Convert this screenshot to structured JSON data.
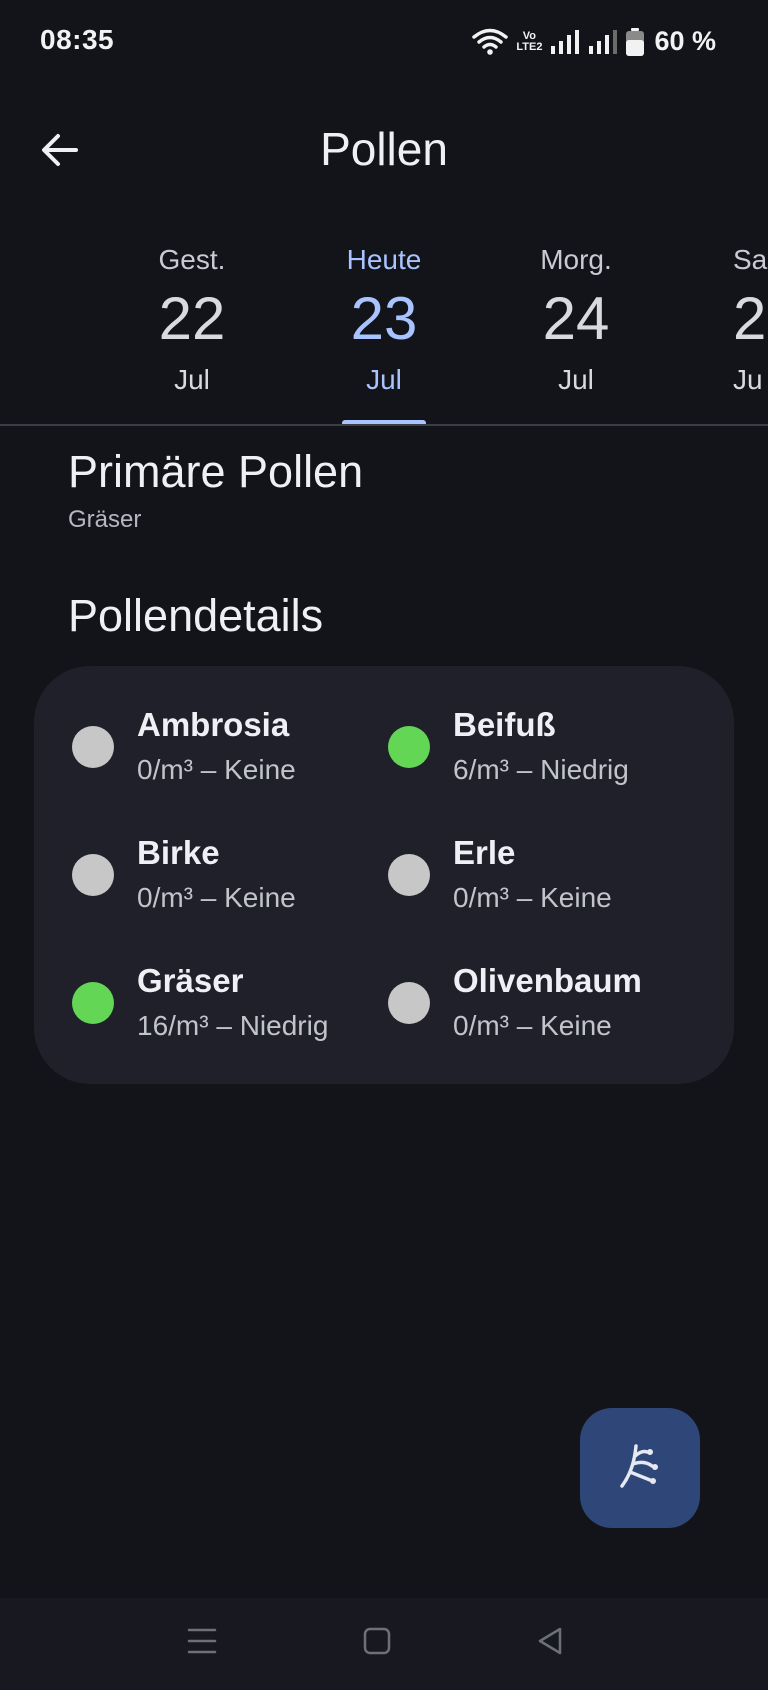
{
  "status_bar": {
    "time": "08:35",
    "volte_top": "Vo",
    "volte_bottom": "LTE2",
    "battery": "60 %"
  },
  "app_bar": {
    "title": "Pollen",
    "back_icon": "arrow-left-icon"
  },
  "date_tabs": [
    {
      "dow": "Gest.",
      "day": "22",
      "month": "Jul",
      "active": false
    },
    {
      "dow": "Heute",
      "day": "23",
      "month": "Jul",
      "active": true
    },
    {
      "dow": "Morg.",
      "day": "24",
      "month": "Jul",
      "active": false
    },
    {
      "dow": "Sa",
      "day": "2",
      "month": "Ju",
      "active": false
    }
  ],
  "primary": {
    "title": "Primäre Pollen",
    "value": "Gräser"
  },
  "details": {
    "title": "Pollendetails",
    "items": [
      {
        "name": "Ambrosia",
        "value": "0/m³ – Keine",
        "level_color": "#c7c7c7"
      },
      {
        "name": "Beifuß",
        "value": "6/m³ – Niedrig",
        "level_color": "#63d655"
      },
      {
        "name": "Birke",
        "value": "0/m³ – Keine",
        "level_color": "#c7c7c7"
      },
      {
        "name": "Erle",
        "value": "0/m³ – Keine",
        "level_color": "#c7c7c7"
      },
      {
        "name": "Gräser",
        "value": "16/m³ – Niedrig",
        "level_color": "#63d655"
      },
      {
        "name": "Olivenbaum",
        "value": "0/m³ – Keine",
        "level_color": "#c7c7c7"
      }
    ]
  },
  "fab": {
    "icon": "pollen-plant-icon"
  },
  "nav_bar": {
    "icons": [
      "menu-icon",
      "home-square-icon",
      "back-triangle-icon"
    ]
  },
  "colors": {
    "accent": "#a9c3ff",
    "background": "#131419",
    "card": "#1f2029",
    "fab": "#2f4679"
  }
}
